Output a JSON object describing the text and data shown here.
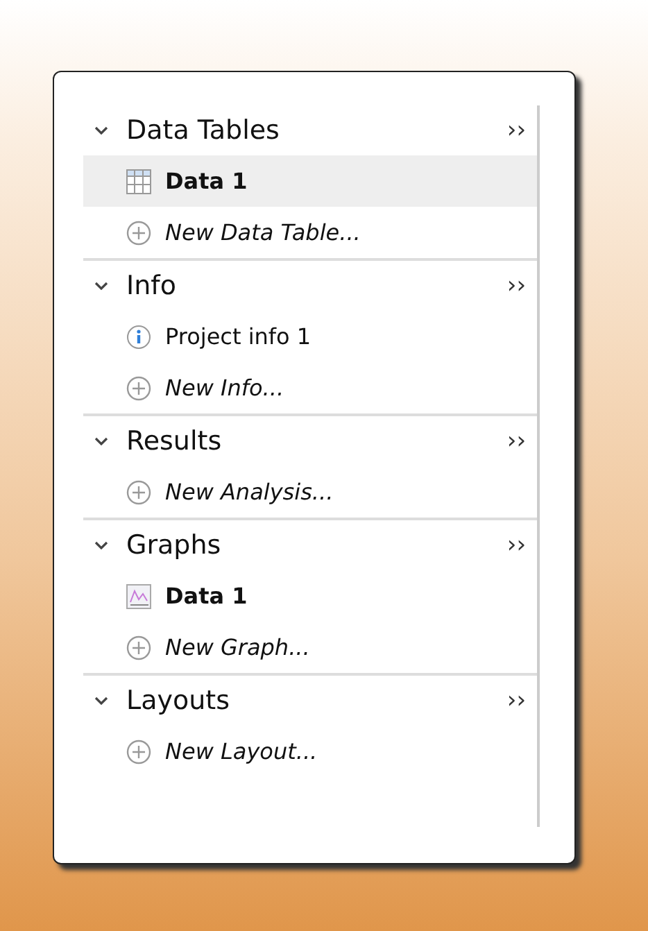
{
  "sections": [
    {
      "title": "Data Tables",
      "expanded": true,
      "more": "››",
      "items": [
        {
          "kind": "table",
          "label": "Data 1",
          "selected": true
        },
        {
          "kind": "new",
          "label": "New Data Table...",
          "selected": false
        }
      ]
    },
    {
      "title": "Info",
      "expanded": true,
      "more": "››",
      "items": [
        {
          "kind": "info",
          "label": "Project info 1",
          "selected": false
        },
        {
          "kind": "new",
          "label": "New Info...",
          "selected": false
        }
      ]
    },
    {
      "title": "Results",
      "expanded": true,
      "more": "››",
      "items": [
        {
          "kind": "new",
          "label": "New Analysis...",
          "selected": false
        }
      ]
    },
    {
      "title": "Graphs",
      "expanded": true,
      "more": "››",
      "items": [
        {
          "kind": "graph",
          "label": "Data 1",
          "selected": false
        },
        {
          "kind": "new",
          "label": "New Graph...",
          "selected": false
        }
      ]
    },
    {
      "title": "Layouts",
      "expanded": true,
      "more": "››",
      "items": [
        {
          "kind": "new",
          "label": "New Layout...",
          "selected": false
        }
      ]
    }
  ]
}
